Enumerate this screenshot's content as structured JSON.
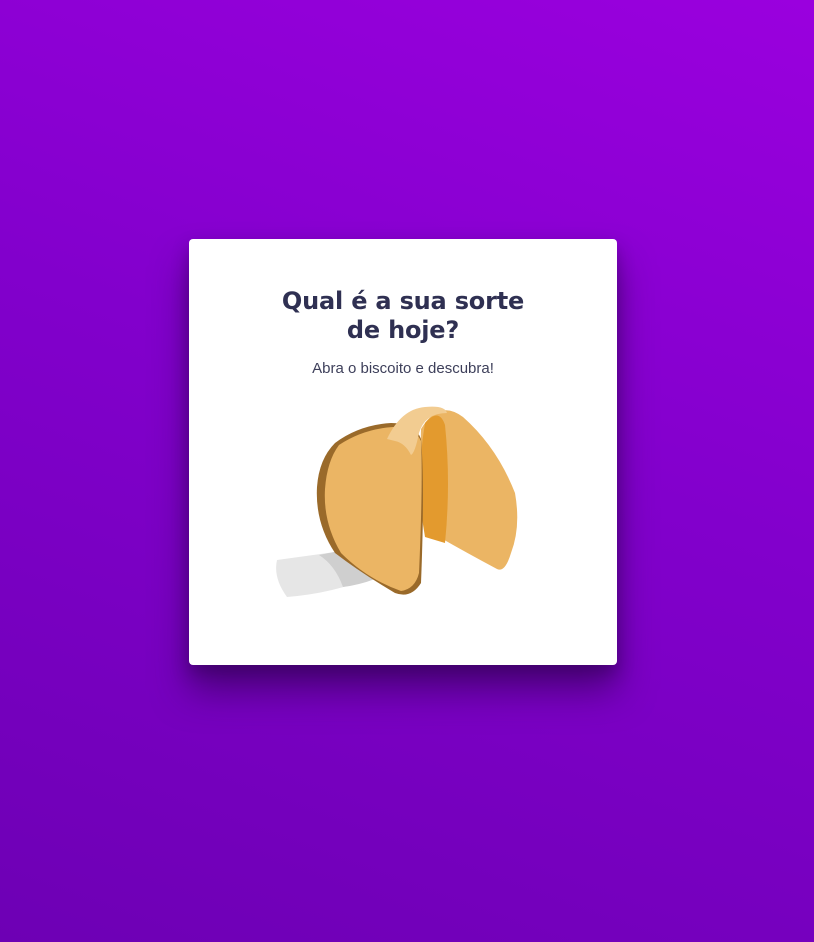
{
  "card": {
    "title_line1": "Qual é a sua sorte",
    "title_line2": "de hoje?",
    "subtitle": "Abra o biscoito e descubra!"
  },
  "cookie": {
    "icon": "fortune-cookie-icon"
  },
  "colors": {
    "background_start": "#9a00de",
    "background_end": "#6d00b4",
    "card": "#ffffff",
    "title": "#2f3052",
    "cookie_body": "#ebb564",
    "cookie_inner": "#e39a2e",
    "cookie_shadow": "#9a6a2a"
  }
}
